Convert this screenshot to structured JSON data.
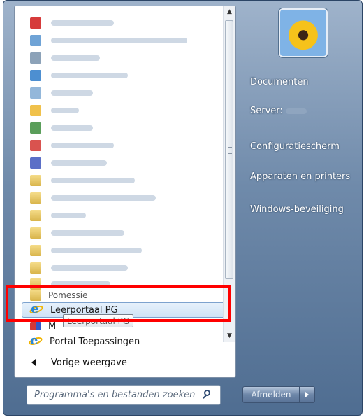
{
  "programs": {
    "folder_label": "Pomessie",
    "selected_label": "Leerportaal PG",
    "partial_label": "M",
    "portal_label": "Portal Toepassingen",
    "tooltip": "Leerportaal PG"
  },
  "back_label": "Vorige weergave",
  "search": {
    "placeholder": "Programma's en bestanden zoeken"
  },
  "right_pane": {
    "documents": "Documenten",
    "server": "Server:",
    "control_panel": "Configuratiescherm",
    "devices": "Apparaten en printers",
    "security": "Windows-beveiliging"
  },
  "shutdown": {
    "label": "Afmelden"
  },
  "icons": [
    "ie-icon",
    "search-icon",
    "back-arrow-icon",
    "avatar",
    "shutdown-arrow-icon"
  ],
  "colors": {
    "highlight": "#ff0000"
  }
}
